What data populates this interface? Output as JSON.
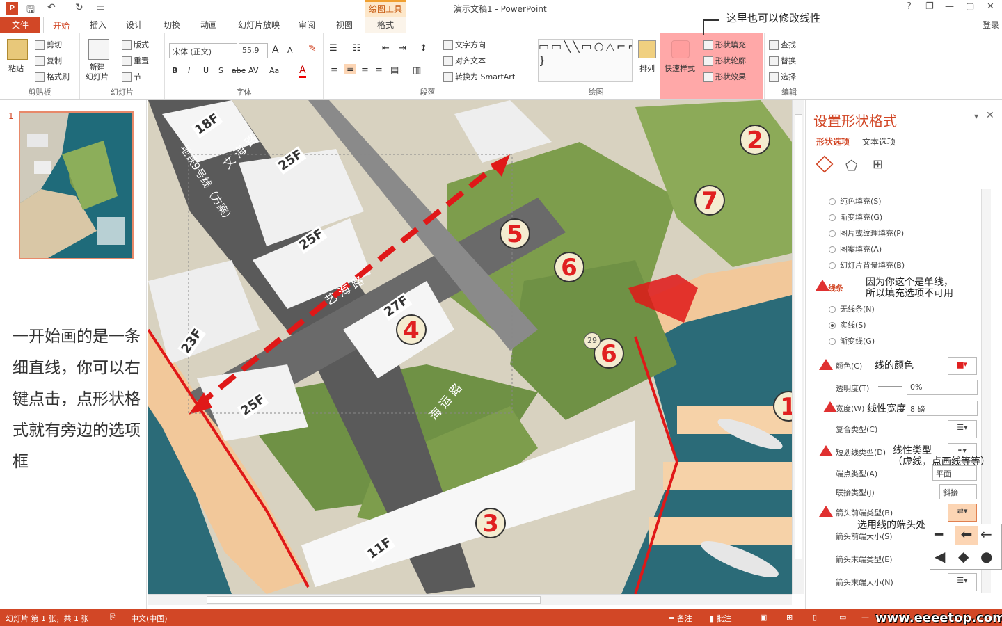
{
  "window": {
    "title": "演示文稿1 - PowerPoint",
    "context_tab": "绘图工具",
    "help": "?",
    "restore": "❐",
    "min": "—",
    "max": "▢",
    "close": "✕",
    "login": "登录"
  },
  "tabs": [
    "文件",
    "开始",
    "插入",
    "设计",
    "切换",
    "动画",
    "幻灯片放映",
    "审阅",
    "视图",
    "格式"
  ],
  "clipboard": {
    "paste": "粘贴",
    "cut": "剪切",
    "copy": "复制",
    "format_painter": "格式刷",
    "label": "剪贴板"
  },
  "slides": {
    "new": "新建\n幻灯片",
    "layout": "版式",
    "reset": "重置",
    "section": "节",
    "label": "幻灯片"
  },
  "font": {
    "name": "宋体 (正文)",
    "size": "55.9",
    "label": "字体",
    "bold": "B",
    "italic": "I",
    "underline": "U",
    "shadow": "S",
    "strike": "abc",
    "spacing": "AV",
    "case": "Aa",
    "color": "A",
    "grow": "A",
    "shrink": "A"
  },
  "paragraph": {
    "label": "段落",
    "text_direction": "文字方向",
    "align_text": "对齐文本",
    "smartart": "转换为 SmartArt"
  },
  "drawing": {
    "label": "绘图",
    "arrange": "排列",
    "quick_styles": "快速样式",
    "shape_fill": "形状填充",
    "shape_outline": "形状轮廓",
    "shape_effects": "形状效果"
  },
  "editing": {
    "label": "编辑",
    "find": "查找",
    "replace": "替换",
    "select": "选择"
  },
  "annotation_top": "这里也可以修改线性",
  "slide_number": "1",
  "left_note": "一开始画的是一条细直线，你可以右键点击，点形状格式就有旁边的选项框",
  "map": {
    "numbers": [
      "5",
      "6",
      "6",
      "4",
      "3",
      "7",
      "2",
      "1"
    ],
    "floors": [
      "18F",
      "25F",
      "25F",
      "27F",
      "23F",
      "25F",
      "11F"
    ],
    "roads": [
      "文 海 路",
      "海 运 路",
      "地铁9号线（方案）",
      "艺 海 路"
    ],
    "marker": "29"
  },
  "pane": {
    "title": "设置形状格式",
    "tab1": "形状选项",
    "tab2": "文本选项",
    "fill_opts": [
      "纯色填充(S)",
      "渐变填充(G)",
      "图片或纹理填充(P)",
      "图案填充(A)",
      "幻灯片背景填充(B)"
    ],
    "line_header": "线条",
    "line_note": "因为你这个是单线，\n所以填充选项不可用",
    "line_opts": [
      "无线条(N)",
      "实线(S)",
      "渐变线(G)"
    ],
    "color_label": "颜色(C)",
    "color_note": "线的颜色",
    "transparency_label": "透明度(T)",
    "transparency_value": "0%",
    "width_label": "宽度(W)",
    "width_note": "线性宽度",
    "width_value": "8 磅",
    "compound_label": "复合类型(C)",
    "dash_label": "短划线类型(D)",
    "dash_note": "线性类型\n（虚线，点画线等等）",
    "cap_label": "端点类型(A)",
    "cap_value": "平面",
    "join_label": "联接类型(J)",
    "join_value": "斜接",
    "begin_type_label": "箭头前端类型(B)",
    "begin_note": "选用线的端头处",
    "begin_size_label": "箭头前端大小(S)",
    "end_type_label": "箭头末端类型(E)",
    "end_size_label": "箭头末端大小(N)"
  },
  "status": {
    "slide_info": "幻灯片 第 1 张，共 1 张",
    "lang": "中文(中国)",
    "notes": "备注",
    "comments": "批注",
    "zoom_minus": "—"
  },
  "watermark": "www.eeeetop.com"
}
